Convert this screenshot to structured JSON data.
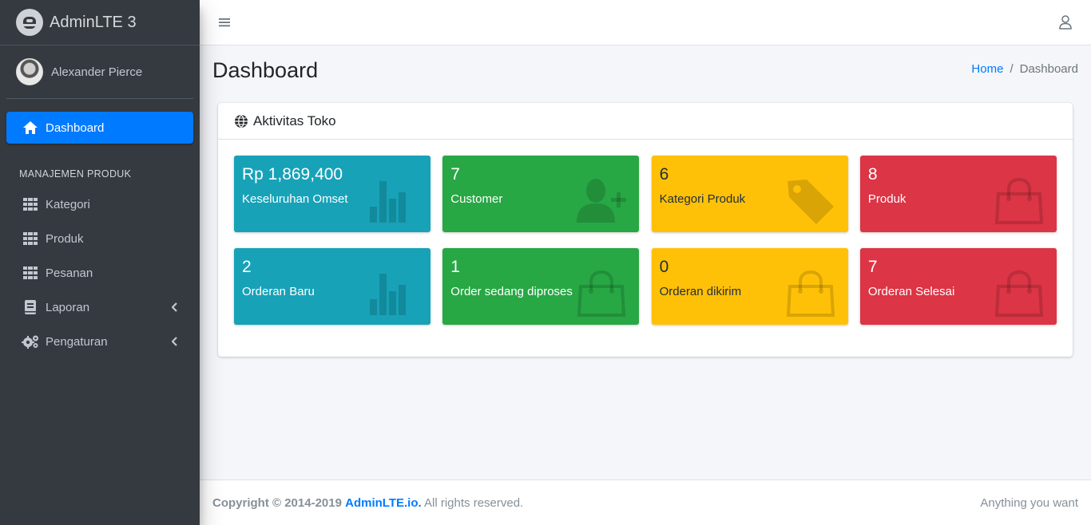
{
  "brand": {
    "name": "AdminLTE 3"
  },
  "user": {
    "name": "Alexander Pierce"
  },
  "sidebar": {
    "active": {
      "label": "Dashboard",
      "icon": "home-icon"
    },
    "section_header": "MANAJEMEN PRODUK",
    "items": [
      {
        "label": "Kategori",
        "icon": "grid-icon"
      },
      {
        "label": "Produk",
        "icon": "grid-icon"
      },
      {
        "label": "Pesanan",
        "icon": "grid-icon"
      },
      {
        "label": "Laporan",
        "icon": "book-icon",
        "has_submenu": true
      },
      {
        "label": "Pengaturan",
        "icon": "cogs-icon",
        "has_submenu": true
      }
    ]
  },
  "header": {
    "title": "Dashboard"
  },
  "breadcrumb": {
    "home": "Home",
    "separator": "/",
    "current": "Dashboard"
  },
  "card": {
    "title": "Aktivitas Toko",
    "boxes": [
      {
        "value": "Rp 1,869,400",
        "label": "Keseluruhan Omset",
        "color": "#17a2b8",
        "icon": "bar-chart-icon"
      },
      {
        "value": "7",
        "label": "Customer",
        "color": "#28a745",
        "icon": "user-plus-icon"
      },
      {
        "value": "6",
        "label": "Kategori Produk",
        "color": "#ffc107",
        "icon": "tag-icon"
      },
      {
        "value": "8",
        "label": "Produk",
        "color": "#dc3545",
        "icon": "shopping-bag-icon"
      },
      {
        "value": "2",
        "label": "Orderan Baru",
        "color": "#17a2b8",
        "icon": "bar-chart-icon"
      },
      {
        "value": "1",
        "label": "Order sedang diproses",
        "color": "#28a745",
        "icon": "shopping-bag-icon"
      },
      {
        "value": "0",
        "label": "Orderan dikirim",
        "color": "#ffc107",
        "icon": "shopping-bag-icon"
      },
      {
        "value": "7",
        "label": "Orderan Selesai",
        "color": "#dc3545",
        "icon": "shopping-bag-icon"
      }
    ]
  },
  "footer": {
    "copyright": "Copyright © 2014-2019",
    "link": "AdminLTE.io.",
    "rights": "All rights reserved.",
    "right_text": "Anything you want"
  }
}
